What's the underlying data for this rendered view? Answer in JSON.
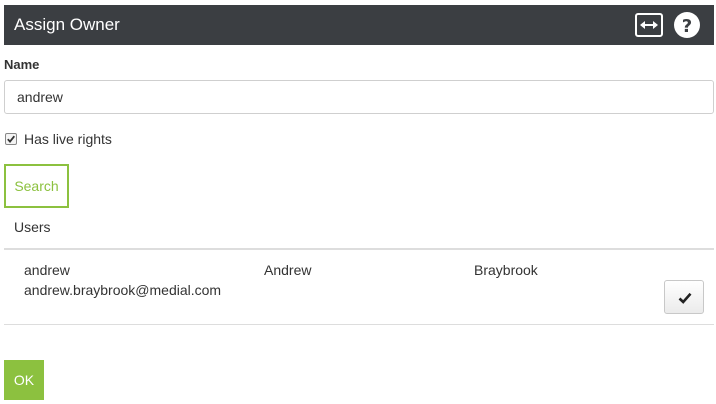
{
  "dialog": {
    "title": "Assign Owner",
    "expand_icon": "expand-horizontal-icon",
    "help_icon": "help-icon"
  },
  "form": {
    "name_label": "Name",
    "name_value": "andrew",
    "has_live_rights_label": "Has live rights",
    "has_live_rights_checked": true,
    "search_label": "Search"
  },
  "results": {
    "header": "Users",
    "rows": [
      {
        "username": "andrew",
        "email": "andrew.braybrook@medial.com",
        "first_name": "Andrew",
        "last_name": "Braybrook",
        "select_icon": "checkmark-icon"
      }
    ]
  },
  "footer": {
    "ok_label": "OK"
  },
  "colors": {
    "titlebar": "#3b3e42",
    "accent_green": "#8cc13f"
  }
}
